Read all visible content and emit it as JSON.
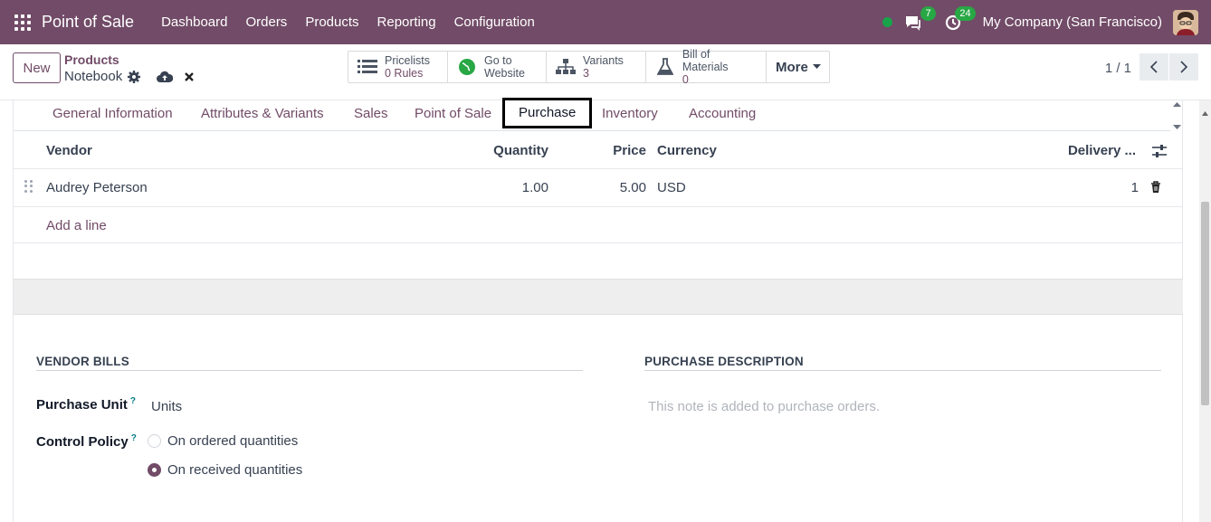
{
  "navbar": {
    "app_name": "Point of Sale",
    "menu": [
      "Dashboard",
      "Orders",
      "Products",
      "Reporting",
      "Configuration"
    ],
    "messages_count": "7",
    "activities_count": "24",
    "company": "My Company (San Francisco)",
    "online_color": "#18a34a",
    "brand_color": "#714b67"
  },
  "control": {
    "new_label": "New",
    "breadcrumb": "Products",
    "record_name": "Notebook",
    "smart_buttons": {
      "pricelists": {
        "label": "Pricelists",
        "value": "0 Rules",
        "icon": "list-icon"
      },
      "website": {
        "label": "Go to",
        "value": "Website",
        "icon": "globe-icon"
      },
      "variants": {
        "label": "Variants",
        "value": "3",
        "icon": "sitemap-icon"
      },
      "bom": {
        "label": "Bill of Materials",
        "value": "0",
        "icon": "flask-icon"
      },
      "more": "More"
    },
    "pager": "1 / 1"
  },
  "tabs": [
    "General Information",
    "Attributes & Variants",
    "Sales",
    "Point of Sale",
    "Purchase",
    "Inventory",
    "Accounting"
  ],
  "vendors_table": {
    "headers": {
      "vendor": "Vendor",
      "quantity": "Quantity",
      "price": "Price",
      "currency": "Currency",
      "delivery": "Delivery ..."
    },
    "rows": [
      {
        "vendor": "Audrey Peterson",
        "quantity": "1.00",
        "price": "5.00",
        "currency": "USD",
        "delivery": "1"
      }
    ],
    "add_line": "Add a line"
  },
  "vendor_bills": {
    "title": "VENDOR BILLS",
    "purchase_unit_label": "Purchase Unit",
    "purchase_unit_value": "Units",
    "control_policy_label": "Control Policy",
    "help_mark": "?",
    "options": [
      "On ordered quantities",
      "On received quantities"
    ],
    "selected_option": "On received quantities"
  },
  "purchase_description": {
    "title": "PURCHASE DESCRIPTION",
    "placeholder": "This note is added to purchase orders."
  }
}
